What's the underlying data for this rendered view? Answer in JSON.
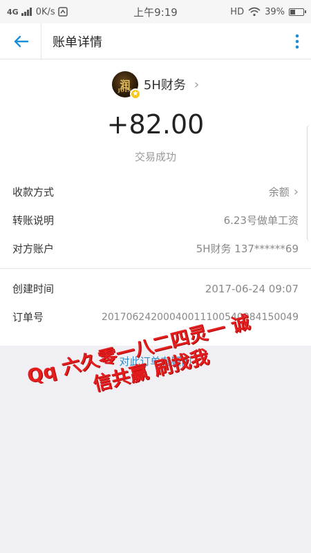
{
  "status_bar": {
    "network": "4G",
    "speed": "0K/s",
    "time": "上午9:19",
    "hd": "HD",
    "battery": "39%",
    "battery_level": 0.39
  },
  "app_bar": {
    "title": "账单详情",
    "back_icon": "back-arrow-icon",
    "more_icon": "more-vertical-icon",
    "accent": "#1a8fd8"
  },
  "payer": {
    "name": "5H财务",
    "avatar_text": "润",
    "avatar_subtext": "JOIN"
  },
  "transaction": {
    "amount": "+82.00",
    "status": "交易成功"
  },
  "details": [
    {
      "label": "收款方式",
      "value": "余额",
      "has_chevron": true
    },
    {
      "label": "转账说明",
      "value": "6.23号做单工资"
    },
    {
      "label": "对方账户",
      "value": "5H财务 137******69"
    }
  ],
  "details2": [
    {
      "label": "创建时间",
      "value": "2017-06-24 09:07"
    },
    {
      "label": "订单号",
      "value": "20170624200040011100540084150049"
    }
  ],
  "question_link": "对此订单有疑问",
  "overlay": {
    "line1": "Qq 六久零一八二四灵一 诚",
    "line2": "信共赢 刷找我",
    "color": "#e41e1e"
  }
}
